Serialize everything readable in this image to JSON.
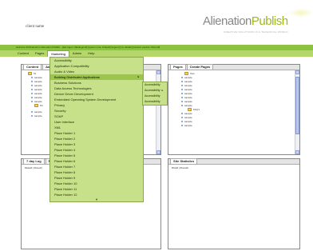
{
  "header": {
    "client_name": "client name",
    "logo_word1": "Alienation",
    "logo_word2": "Publish",
    "tagline": "CREATIVE SOLUTIONS IN A TECHNICAL WORLD"
  },
  "info_bar": {
    "text": "welcome #fullname# to Alienation Publish - [last logon: #lastlogon#] [system role: #roles#] [logout] [my details] [session expires: #timer#]"
  },
  "menu": {
    "items": [
      "Content",
      "Pages",
      "Marketing",
      "Admin",
      "Help"
    ],
    "active": "Marketing"
  },
  "content_panel": {
    "tabs": [
      "Content",
      "Ad"
    ],
    "root_folder": "Te",
    "items": [
      "sample",
      "sample",
      "sample",
      "sample",
      "sample",
      "sample",
      "sample"
    ],
    "sub_folder": "FA",
    "bottom_items": [
      "sample",
      "sample"
    ]
  },
  "pages_panel": {
    "tabs": [
      "Pages",
      "Create Pages"
    ],
    "root_folder": "Test",
    "items": [
      "sample",
      "sample",
      "sample",
      "sample",
      "sample",
      "sample",
      "sample",
      "sample"
    ],
    "faq_folder": "FAQ's",
    "bottom_items": [
      "sample",
      "sample",
      "sample",
      "sample"
    ]
  },
  "log_panel": {
    "tabs": [
      "7 day Log",
      "R"
    ],
    "text": "#date# | #time# |"
  },
  "stats_panel": {
    "title": "Site Statistics",
    "text": "#hits# | #trend#"
  },
  "dropdown": {
    "items": [
      "Accessibility",
      "Application Compatibility",
      "Audio & Video",
      "Building Distributed Applications",
      "Business Solutions",
      "Data Access Technologies",
      "Device Driver Development",
      "Embedded Operating System Development",
      "Privacy",
      "Security",
      "SOAP",
      "User Interface",
      "XML",
      "Place Holder 1",
      "Place Holder 2",
      "Place Holder 3",
      "Place Holder 4",
      "Place Holder 5",
      "Place Holder 6",
      "Place Holder 7",
      "Place Holder 8",
      "Place Holder 9",
      "Place Holder 10",
      "Place Holder 11",
      "Place Holder 12"
    ],
    "active": "Building Distributed Applications",
    "more_arrow": "▼"
  },
  "submenu": {
    "items": [
      "Accessibility",
      "Accessibility",
      "Accessibility",
      "Accessibility"
    ],
    "arrow": "►"
  },
  "colors": {
    "info_bar": "#8bc23f",
    "menu_bar": "#b4d66a",
    "dropdown": "#c7e08a",
    "dropdown_active": "#9cc64b",
    "logo_accent": "#9db81c"
  }
}
